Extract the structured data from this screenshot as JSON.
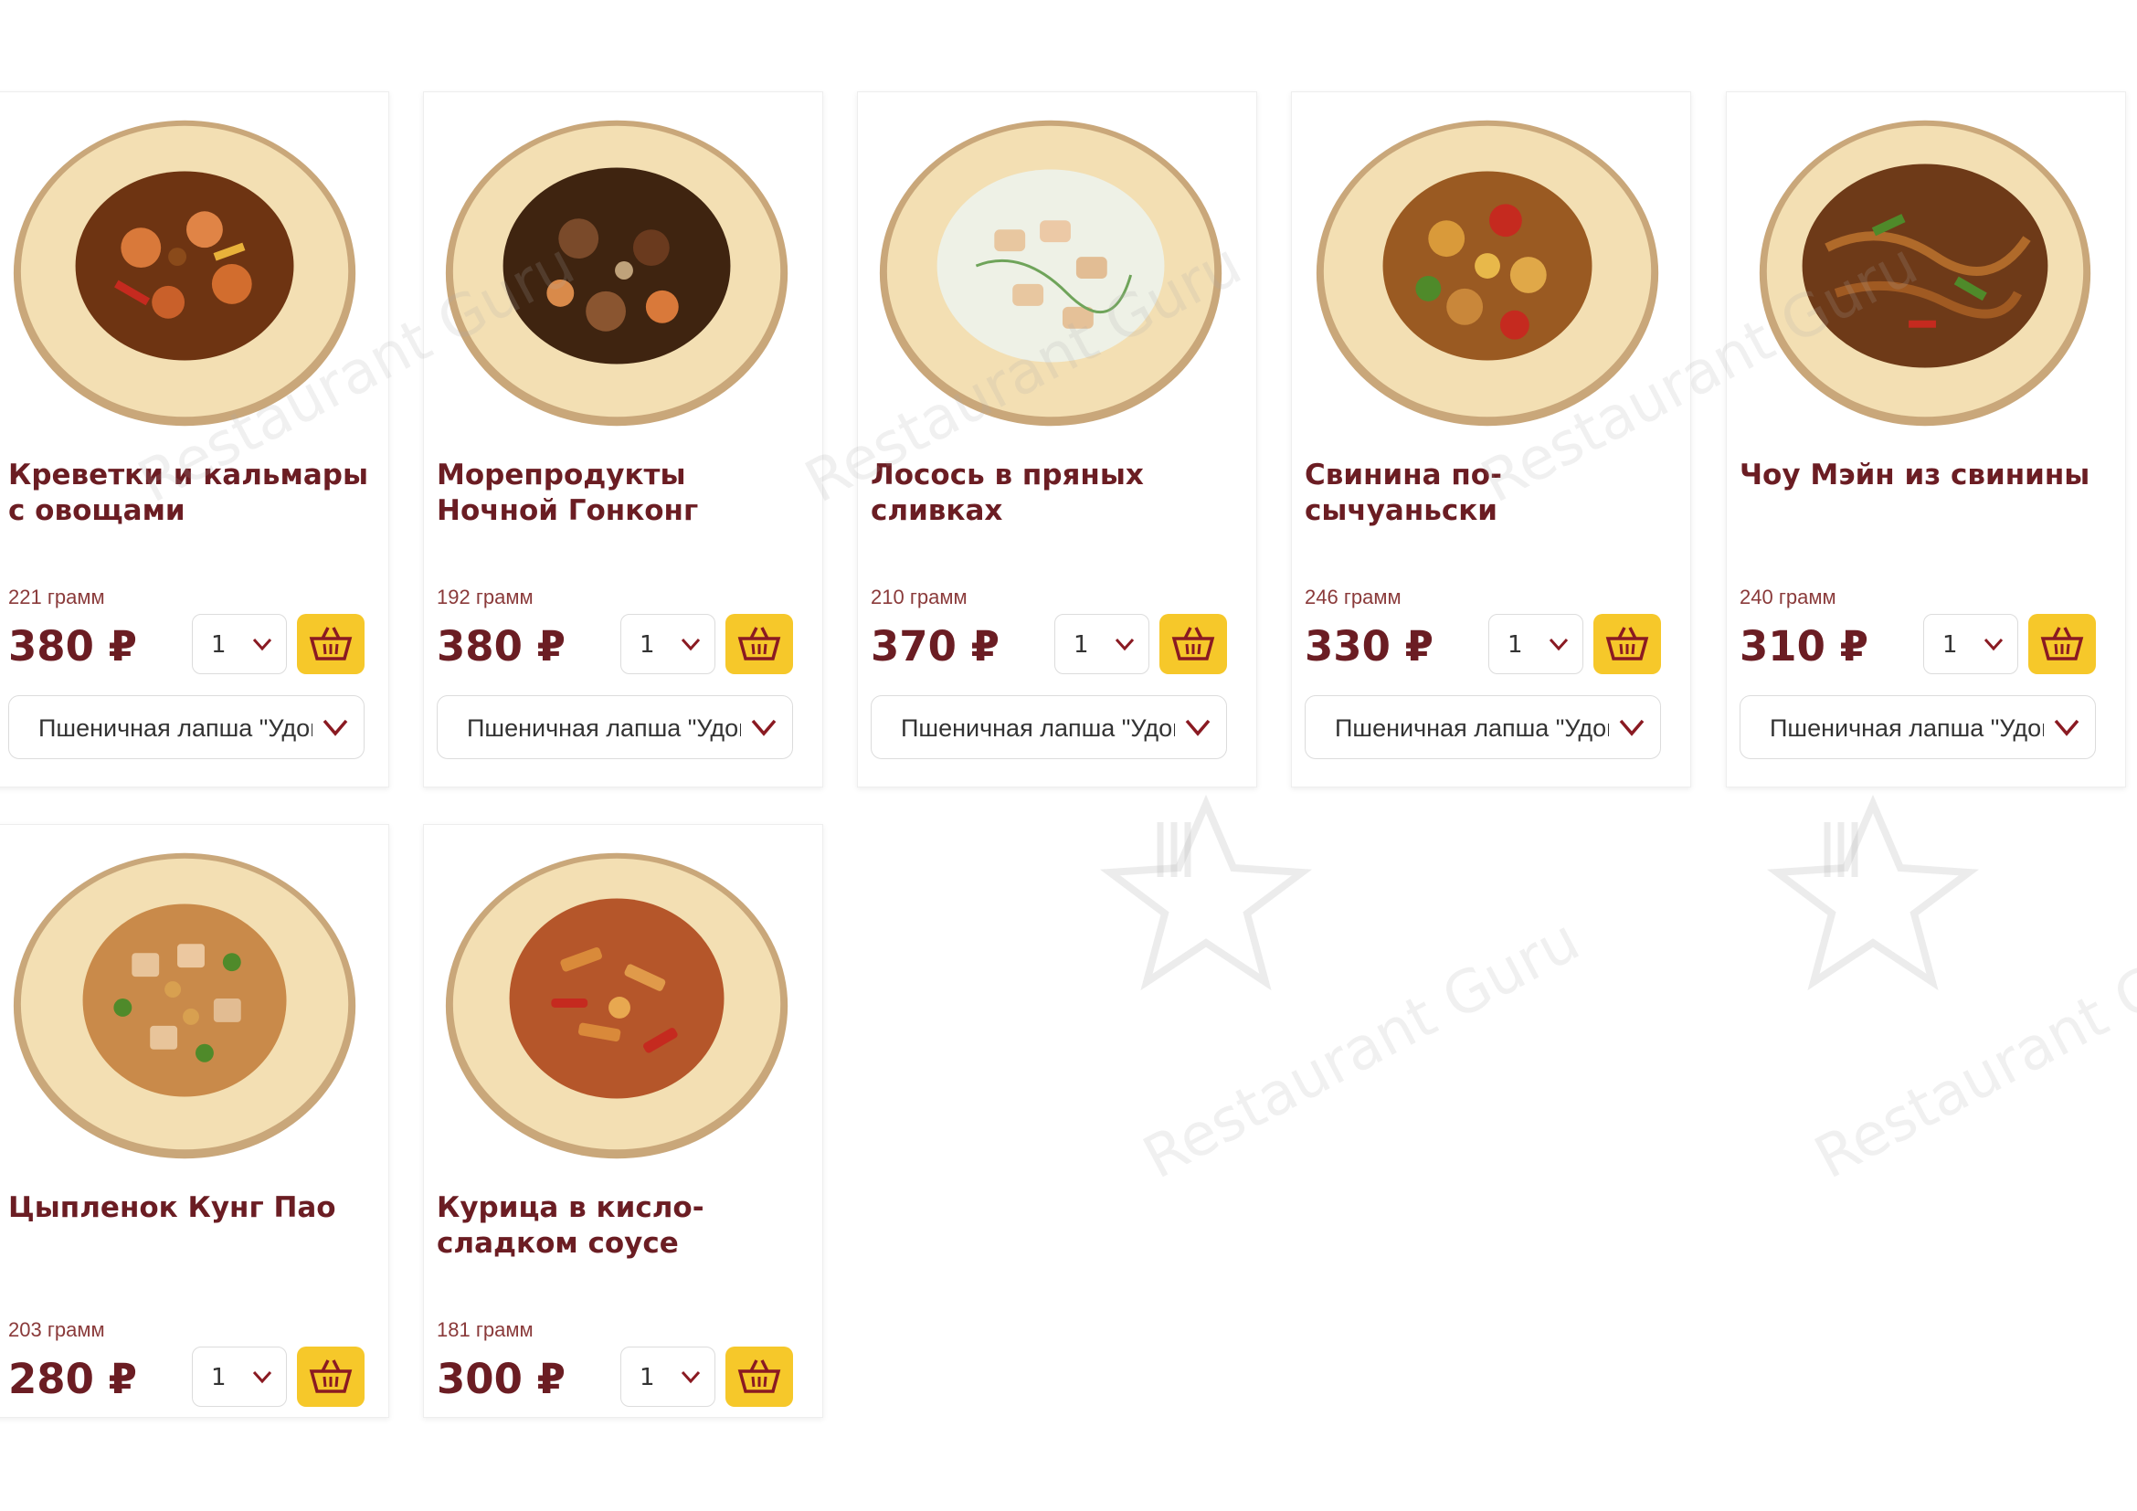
{
  "watermark_text": "Restaurant Guru",
  "colors": {
    "title": "#6b1d23",
    "accent": "#f6c82a",
    "border": "#dcdcdc"
  },
  "products": [
    {
      "title_line1": "Креветки и кальмары",
      "title_line2": "с овощами",
      "weight": "221 грамм",
      "price": "380 ₽",
      "quantity": "1",
      "noodle": "Пшеничная лапша \"Удон\"",
      "image": "shrimp-calamari-plate"
    },
    {
      "title_line1": "Морепродукты",
      "title_line2": "Ночной Гонконг",
      "weight": "192 грамм",
      "price": "380 ₽",
      "quantity": "1",
      "noodle": "Пшеничная лапша \"Удон\"",
      "image": "seafood-plate"
    },
    {
      "title_line1": "Лосось в пряных",
      "title_line2": "сливках",
      "weight": "210 грамм",
      "price": "370 ₽",
      "quantity": "1",
      "noodle": "Пшеничная лапша \"Удон\"",
      "image": "salmon-cream-plate"
    },
    {
      "title_line1": "Свинина по-",
      "title_line2": "сычуаньски",
      "weight": "246 грамм",
      "price": "330 ₽",
      "quantity": "1",
      "noodle": "Пшеничная лапша \"Удон\"",
      "image": "sichuan-pork-plate"
    },
    {
      "title_line1": "Чоу Мэйн из свинины",
      "title_line2": "",
      "weight": "240 грамм",
      "price": "310 ₽",
      "quantity": "1",
      "noodle": "Пшеничная лапша \"Удон\"",
      "image": "chow-mein-plate"
    },
    {
      "title_line1": "Цыпленок Кунг Пао",
      "title_line2": "",
      "weight": "203 грамм",
      "price": "280 ₽",
      "quantity": "1",
      "image": "kung-pao-plate"
    },
    {
      "title_line1": "Курица в кисло-",
      "title_line2": "сладком соусе",
      "weight": "181 грамм",
      "price": "300 ₽",
      "quantity": "1",
      "image": "sweet-sour-chicken-plate"
    }
  ]
}
